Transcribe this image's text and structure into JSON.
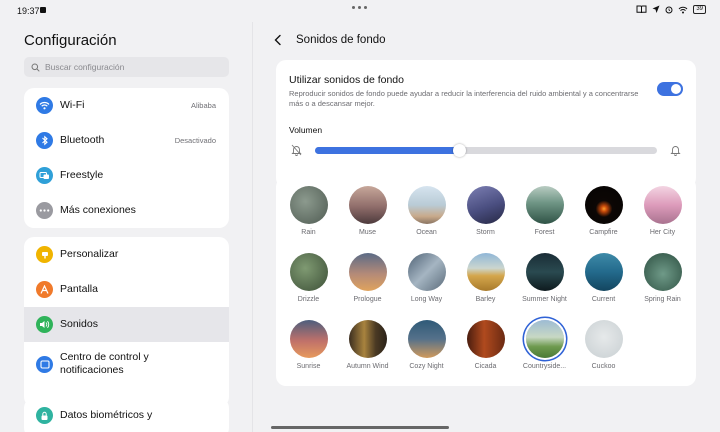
{
  "status_bar": {
    "time": "19:37",
    "battery": "39"
  },
  "left_panel": {
    "title": "Configuración",
    "search_placeholder": "Buscar configuración",
    "group1": [
      {
        "label": "Wi-Fi",
        "value": "Alibaba",
        "icon": "wifi-icon",
        "color": "#2f7ae5"
      },
      {
        "label": "Bluetooth",
        "value": "Desactivado",
        "icon": "bluetooth-icon",
        "color": "#2f7ae5"
      },
      {
        "label": "Freestyle",
        "value": "",
        "icon": "freestyle-icon",
        "color": "#2fa0d8"
      },
      {
        "label": "Más conexiones",
        "value": "",
        "icon": "more-icon",
        "color": "#9a9aa0"
      }
    ],
    "group2": [
      {
        "label": "Personalizar",
        "icon": "palette-icon",
        "color": "#f0b400"
      },
      {
        "label": "Pantalla",
        "icon": "display-icon",
        "color": "#f07a2b"
      },
      {
        "label": "Sonidos",
        "icon": "sound-icon",
        "color": "#2fb35a"
      },
      {
        "label": "Centro de control y notificaciones",
        "icon": "notifications-icon",
        "color": "#2f7ae5"
      }
    ],
    "group3": [
      {
        "label": "Datos biométricos y",
        "icon": "lock-icon",
        "color": "#2fb3a0"
      }
    ]
  },
  "right_panel": {
    "title": "Sonidos de fondo",
    "toggle_title": "Utilizar sonidos de fondo",
    "toggle_description": "Reproducir sonidos de fondo puede ayudar a reducir la interferencia del ruido ambiental y a concentrarse más o a descansar mejor.",
    "toggle_on": true,
    "volume_label": "Volumen",
    "volume_level": 0.42,
    "accent_color": "#3d72e0",
    "sounds": [
      {
        "label": "Rain",
        "bg": "radial-gradient(circle at 40% 40%, #8c9a8e, #4f5b52)",
        "selected": false
      },
      {
        "label": "Muse",
        "bg": "linear-gradient(180deg, #c7a79a 0%, #8f6d6a 55%, #4d3a3c 100%)",
        "selected": false
      },
      {
        "label": "Ocean",
        "bg": "linear-gradient(180deg, #d6e4ef 0%, #b9cbd6 50%, #c8a98a 80%, #8a7462 100%)",
        "selected": false
      },
      {
        "label": "Storm",
        "bg": "linear-gradient(160deg, #7c7fb3 0%, #4a4e80 55%, #262844 100%)",
        "selected": false
      },
      {
        "label": "Forest",
        "bg": "linear-gradient(180deg, #b9ccc2 0%, #6e9484 45%, #2f5346 100%)",
        "selected": false
      },
      {
        "label": "Campfire",
        "bg": "radial-gradient(circle at 50% 60%, #ff9c2a 0%, #c4480a 10%, #0c0705 28%, #050302 100%)",
        "selected": false
      },
      {
        "label": "Her City",
        "bg": "linear-gradient(180deg, #f3d4e2 0%, #dd9bbb 50%, #a9738f 100%)",
        "selected": false
      },
      {
        "label": "Drizzle",
        "bg": "radial-gradient(circle at 40% 40%, #7f9a72, #3c4f37)",
        "selected": false
      },
      {
        "label": "Prologue",
        "bg": "linear-gradient(180deg, #5b6b86 0%, #b48a78 55%, #e0a35d 100%)",
        "selected": false
      },
      {
        "label": "Long Way",
        "bg": "linear-gradient(135deg, #4f6275 0%, #a5b5c2 50%, #5a6b7a 100%)",
        "selected": false
      },
      {
        "label": "Barley",
        "bg": "linear-gradient(180deg, #8fb6d7 0%, #cbd6cf 40%, #d4a64c 60%, #a87a2a 100%)",
        "selected": false
      },
      {
        "label": "Summer Night",
        "bg": "linear-gradient(180deg, #1a2c36 0%, #2a4a50 50%, #0e1a1e 100%)",
        "selected": false
      },
      {
        "label": "Current",
        "bg": "linear-gradient(180deg, #3e8aa8 0%, #236a8c 50%, #13455f 100%)",
        "selected": false
      },
      {
        "label": "Spring Rain",
        "bg": "radial-gradient(circle at 50% 55%, #6f9a88, #2c4e40)",
        "selected": false
      },
      {
        "label": "Sunrise",
        "bg": "linear-gradient(180deg, #4d5e7d 0%, #c0716a 55%, #e79a5d 100%)",
        "selected": false
      },
      {
        "label": "Autumn Wind",
        "bg": "linear-gradient(90deg, #3b2e20 0%, #a8833e 40%, #4b3a24 70%, #2b2219 100%)",
        "selected": false
      },
      {
        "label": "Cozy Night",
        "bg": "linear-gradient(180deg, #2f5a78 0%, #55718a 50%, #d09a5c 100%)",
        "selected": false
      },
      {
        "label": "Cicada",
        "bg": "linear-gradient(90deg, #4a1d0f 0%, #b04a1e 45%, #6b2a12 100%)",
        "selected": false
      },
      {
        "label": "Countryside...",
        "bg": "linear-gradient(180deg, #9dbbd3 0%, #c8d8c4 45%, #6e9a4f 70%, #4a7a35 100%)",
        "selected": true
      },
      {
        "label": "Cuckoo",
        "bg": "radial-gradient(circle at 50% 45%, #e6e9ea, #c8cfd2)",
        "selected": false
      }
    ]
  }
}
